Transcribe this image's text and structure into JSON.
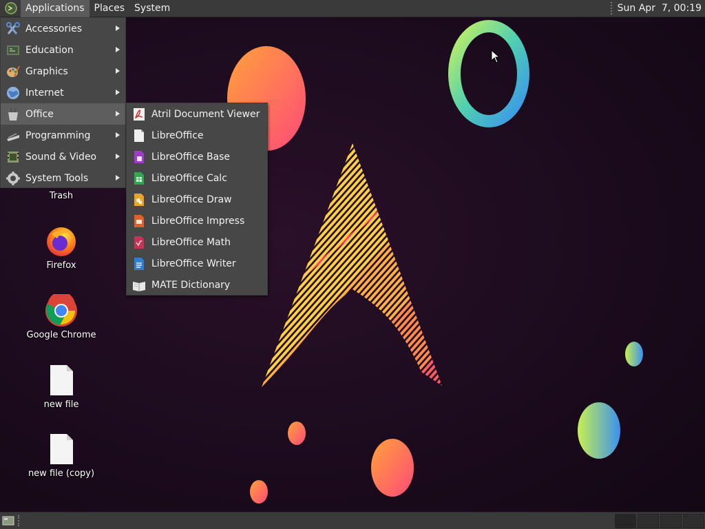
{
  "top_panel": {
    "menus": [
      "Applications",
      "Places",
      "System"
    ],
    "clock": "Sun Apr  7, 00:19"
  },
  "app_menu": {
    "items": [
      {
        "label": "Accessories",
        "icon": "accessories-icon"
      },
      {
        "label": "Education",
        "icon": "education-icon"
      },
      {
        "label": "Graphics",
        "icon": "graphics-icon"
      },
      {
        "label": "Internet",
        "icon": "internet-icon"
      },
      {
        "label": "Office",
        "icon": "office-icon"
      },
      {
        "label": "Programming",
        "icon": "programming-icon"
      },
      {
        "label": "Sound & Video",
        "icon": "sound-video-icon"
      },
      {
        "label": "System Tools",
        "icon": "system-tools-icon"
      }
    ],
    "hovered": "Office"
  },
  "office_submenu": {
    "items": [
      {
        "label": "Atril Document Viewer",
        "icon": "atril-icon"
      },
      {
        "label": "LibreOffice",
        "icon": "libreoffice-icon"
      },
      {
        "label": "LibreOffice Base",
        "icon": "libreoffice-base-icon",
        "color": "#9b3fc6"
      },
      {
        "label": "LibreOffice Calc",
        "icon": "libreoffice-calc-icon",
        "color": "#2fa84f"
      },
      {
        "label": "LibreOffice Draw",
        "icon": "libreoffice-draw-icon",
        "color": "#e8a52c"
      },
      {
        "label": "LibreOffice Impress",
        "icon": "libreoffice-impress-icon",
        "color": "#e0602a"
      },
      {
        "label": "LibreOffice Math",
        "icon": "libreoffice-math-icon",
        "color": "#c8325a"
      },
      {
        "label": "LibreOffice Writer",
        "icon": "libreoffice-writer-icon",
        "color": "#2f7ed0"
      },
      {
        "label": "MATE Dictionary",
        "icon": "dictionary-icon"
      }
    ]
  },
  "desktop_icons": [
    {
      "label": "Trash",
      "icon": "trash-icon"
    },
    {
      "label": "Firefox",
      "icon": "firefox-icon"
    },
    {
      "label": "Google Chrome",
      "icon": "chrome-icon"
    },
    {
      "label": "new file",
      "icon": "file-icon"
    },
    {
      "label": "new file (copy)",
      "icon": "file-icon"
    }
  ],
  "colors": {
    "panel": "#3a3a3a",
    "menu_bg": "#474747",
    "menu_hover": "#5e5e5e"
  }
}
